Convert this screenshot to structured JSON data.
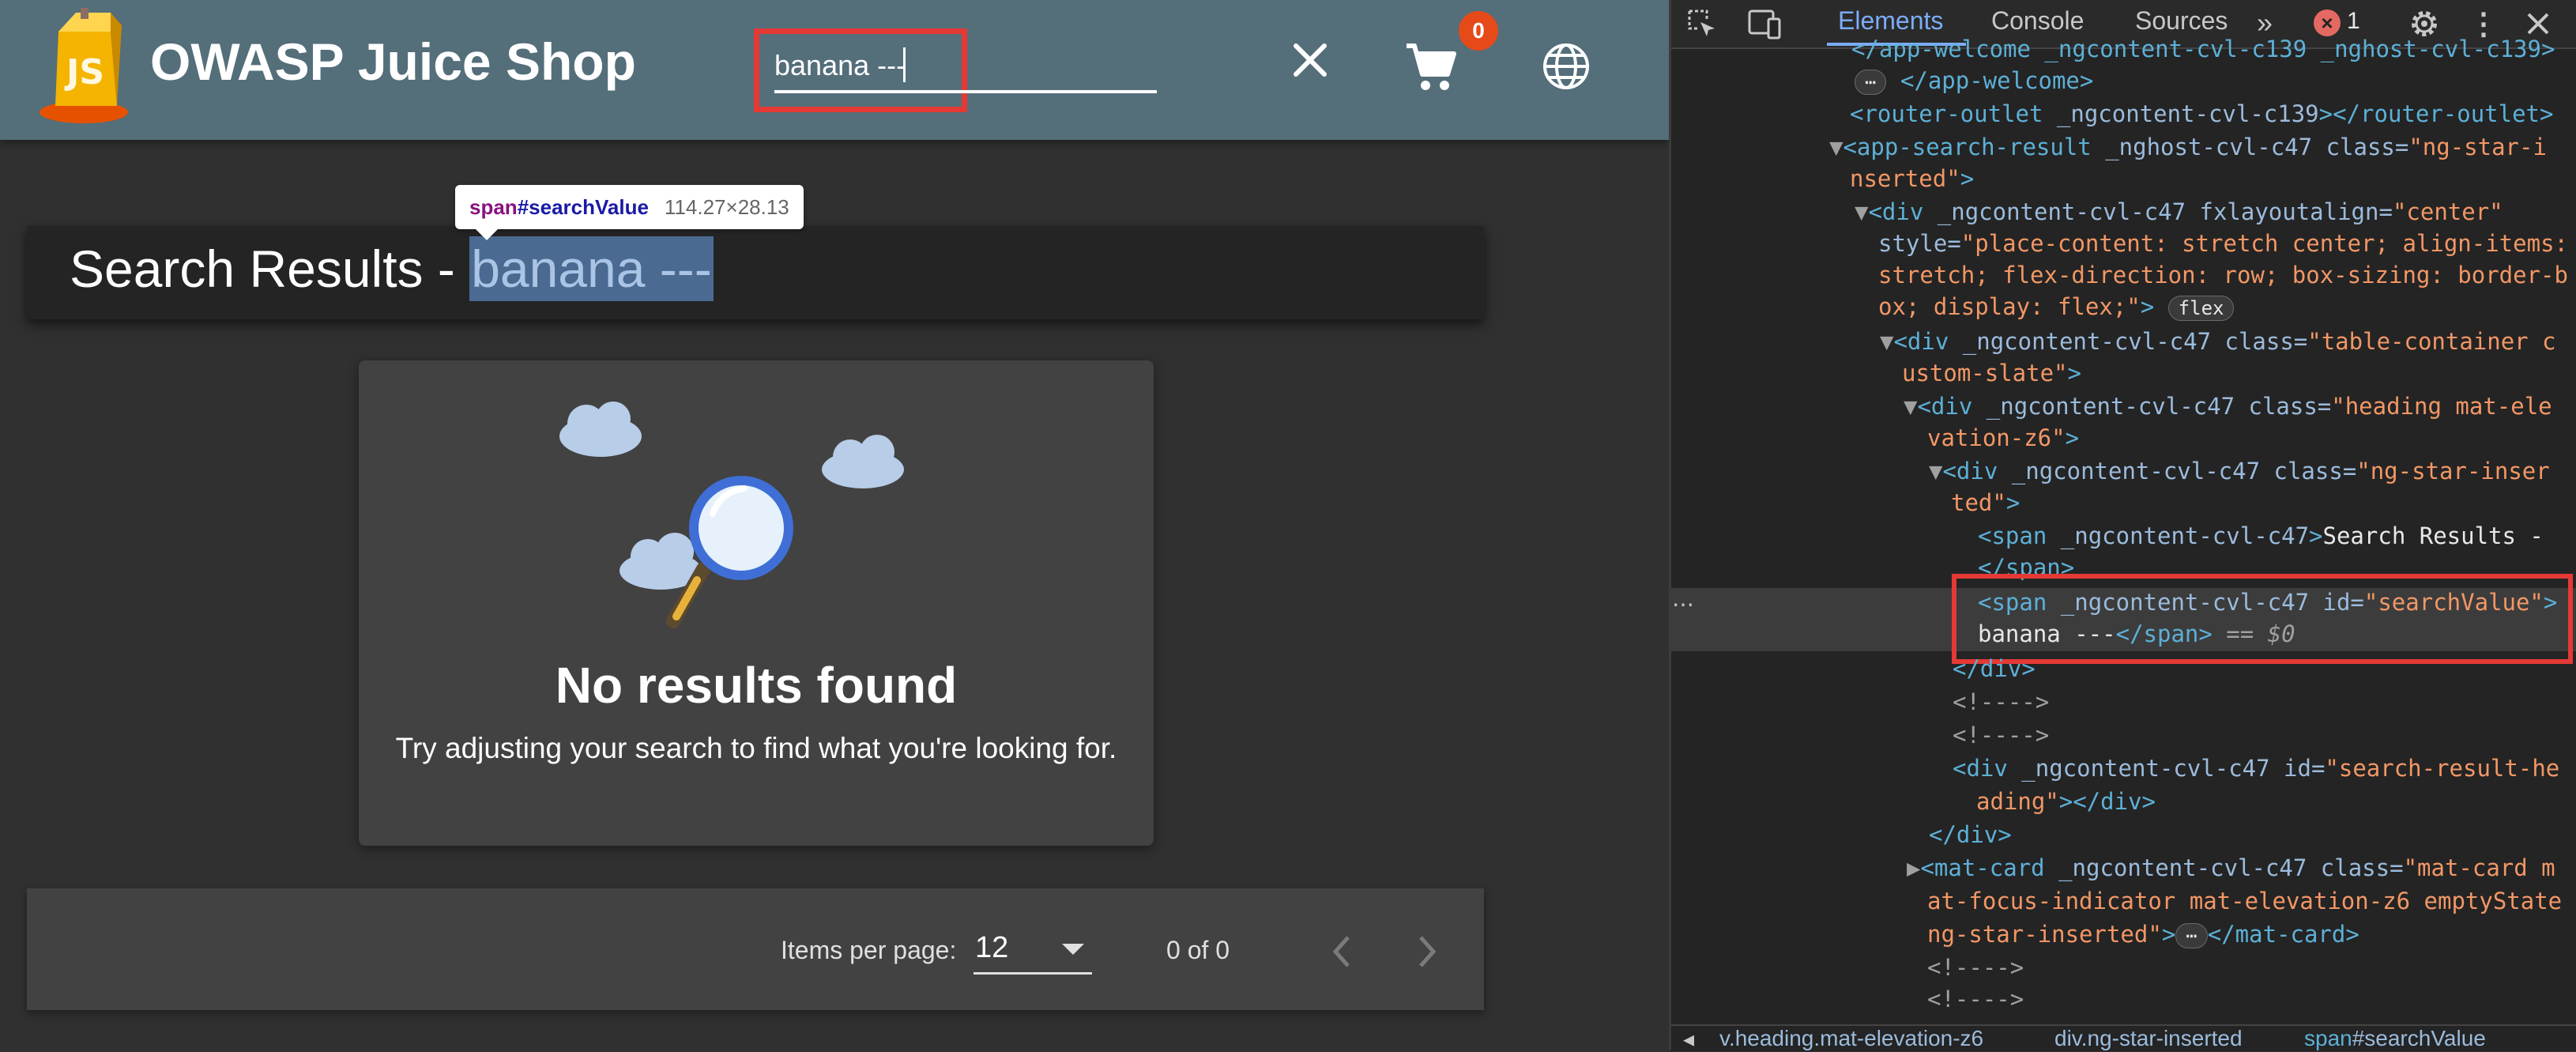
{
  "app": {
    "title": "OWASP Juice Shop",
    "search": {
      "value": "banana ---"
    },
    "cart": {
      "count": "0"
    },
    "tooltip": {
      "tag": "span",
      "id": "#searchValue",
      "size": "114.27×28.13"
    },
    "heading": {
      "prefix": "Search Results - ",
      "value": "banana ---"
    },
    "empty_state": {
      "title": "No results found",
      "description": "Try adjusting your search to find what you're looking for."
    },
    "paginator": {
      "items_per_page_label": "Items per page:",
      "items_per_page_value": "12",
      "range_label": "0 of 0"
    }
  },
  "devtools": {
    "tabs": {
      "elements": "Elements",
      "console": "Console",
      "sources": "Sources"
    },
    "more_tabs": "»",
    "error_count": "1",
    "error_glyph": "×",
    "kebab": "⋮",
    "ellipsis": "⋯",
    "lines": {
      "l0a": "</app-welcome _ngcontent-cvl-c139 _nghost-cvl-c139>",
      "l1a": "</app-welcome>",
      "l2a": "<router-outlet",
      "l2b": " _ngcontent-cvl-c139",
      "l2c": "></router-outlet>",
      "l3a": "<app-search-result",
      "l3b": " _nghost-cvl-c47",
      "l3c": " class=",
      "l3d": "\"ng-star-i",
      "l4a": "nserted\"",
      "l4b": ">",
      "l5a": "<div",
      "l5b": " _ngcontent-cvl-c47 fxlayoutalign=",
      "l5c": "\"center\"",
      "l6a": "style=",
      "l6b": "\"place-content: stretch center; align-items:",
      "l7a": "stretch; flex-direction: row; box-sizing: border-b",
      "l8a": "ox; display: flex;\"",
      "l8b": ">",
      "l8c": "flex",
      "l9a": "<div",
      "l9b": " _ngcontent-cvl-c47 class=",
      "l9c": "\"table-container c",
      "l10a": "ustom-slate\"",
      "l10b": ">",
      "l11a": "<div",
      "l11b": " _ngcontent-cvl-c47 class=",
      "l11c": "\"heading mat-ele",
      "l12a": "vation-z6\"",
      "l12b": ">",
      "l13a": "<div",
      "l13b": " _ngcontent-cvl-c47 class=",
      "l13c": "\"ng-star-inser",
      "l14a": "ted\"",
      "l14b": ">",
      "l15a": "<span",
      "l15b": " _ngcontent-cvl-c47",
      "l15c": ">",
      "l15d": "Search Results -",
      "l16a": "</span>",
      "l17a": "<span",
      "l17b": " _ngcontent-cvl-c47 id=",
      "l17c": "\"searchValue\"",
      "l17d": ">",
      "l18a": "banana ---",
      "l18b": "</span>",
      "l18c": " == $0",
      "l19a": "</div>",
      "l20a": "<!---->",
      "l21a": "<!---->",
      "l22a": "<div",
      "l22b": " _ngcontent-cvl-c47 id=",
      "l22c": "\"search-result-he",
      "l23a": "ading\"",
      "l23b": "></div>",
      "l24a": "</div>",
      "l25a": "<mat-card",
      "l25b": " _ngcontent-cvl-c47 class=",
      "l25c": "\"mat-card m",
      "l26a": "at-focus-indicator mat-elevation-z6 emptyState",
      "l27a": "ng-star-inserted\"",
      "l27b": ">",
      "l27c": "⋯",
      "l27d": "</mat-card>",
      "l28a": "<!---->",
      "l29a": "<!---->"
    },
    "breadcrumbs": {
      "c1": "v.heading.mat-elevation-z6",
      "c2": "div.ng-star-inserted",
      "c3a": "span",
      "c3b": "#searchValue"
    }
  },
  "colors": {
    "toolbar": "#546e7a",
    "highlight": "#e53935",
    "badge": "#e64a19",
    "devtools_bg": "#242424"
  }
}
